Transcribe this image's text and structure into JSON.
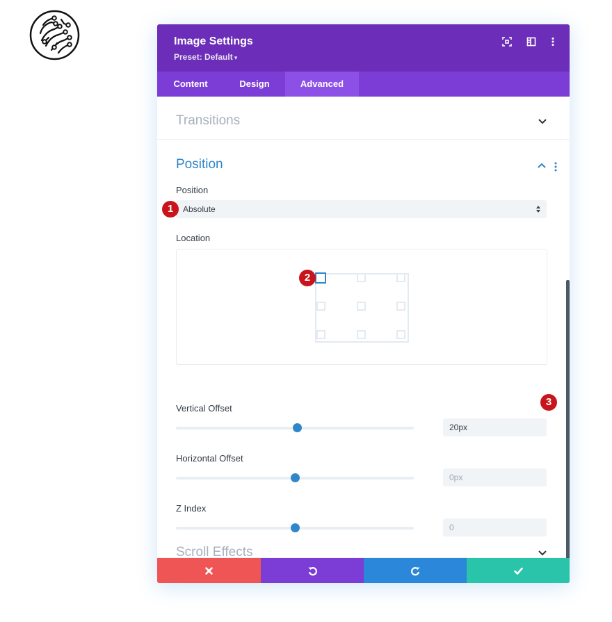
{
  "header": {
    "title": "Image Settings",
    "preset": "Preset: Default"
  },
  "tabs": [
    {
      "label": "Content"
    },
    {
      "label": "Design"
    },
    {
      "label": "Advanced",
      "active": true
    }
  ],
  "sections": {
    "transitions": {
      "title": "Transitions",
      "expanded": false
    },
    "position": {
      "title": "Position",
      "expanded": true,
      "position_label": "Position",
      "position_value": "Absolute",
      "location_label": "Location",
      "location_selected": "top-left",
      "vertical_offset": {
        "label": "Vertical Offset",
        "value": "20px",
        "slider_percent": 51
      },
      "horizontal_offset": {
        "label": "Horizontal Offset",
        "placeholder": "0px",
        "slider_percent": 50
      },
      "z_index": {
        "label": "Z Index",
        "placeholder": "0",
        "slider_percent": 50
      }
    },
    "scroll_effects": {
      "title": "Scroll Effects",
      "expanded": false
    }
  },
  "badges": [
    "1",
    "2",
    "3"
  ],
  "footer": {
    "buttons": [
      "close",
      "undo",
      "redo",
      "save"
    ]
  },
  "colors": {
    "header": "#6c2eb9",
    "tabs": "#7b3dd5",
    "accent": "#2f86c9",
    "cancel": "#ef5555",
    "undo": "#7b3dd5",
    "redo": "#2b87da",
    "save": "#29c4a9",
    "badge": "#c8141a"
  }
}
